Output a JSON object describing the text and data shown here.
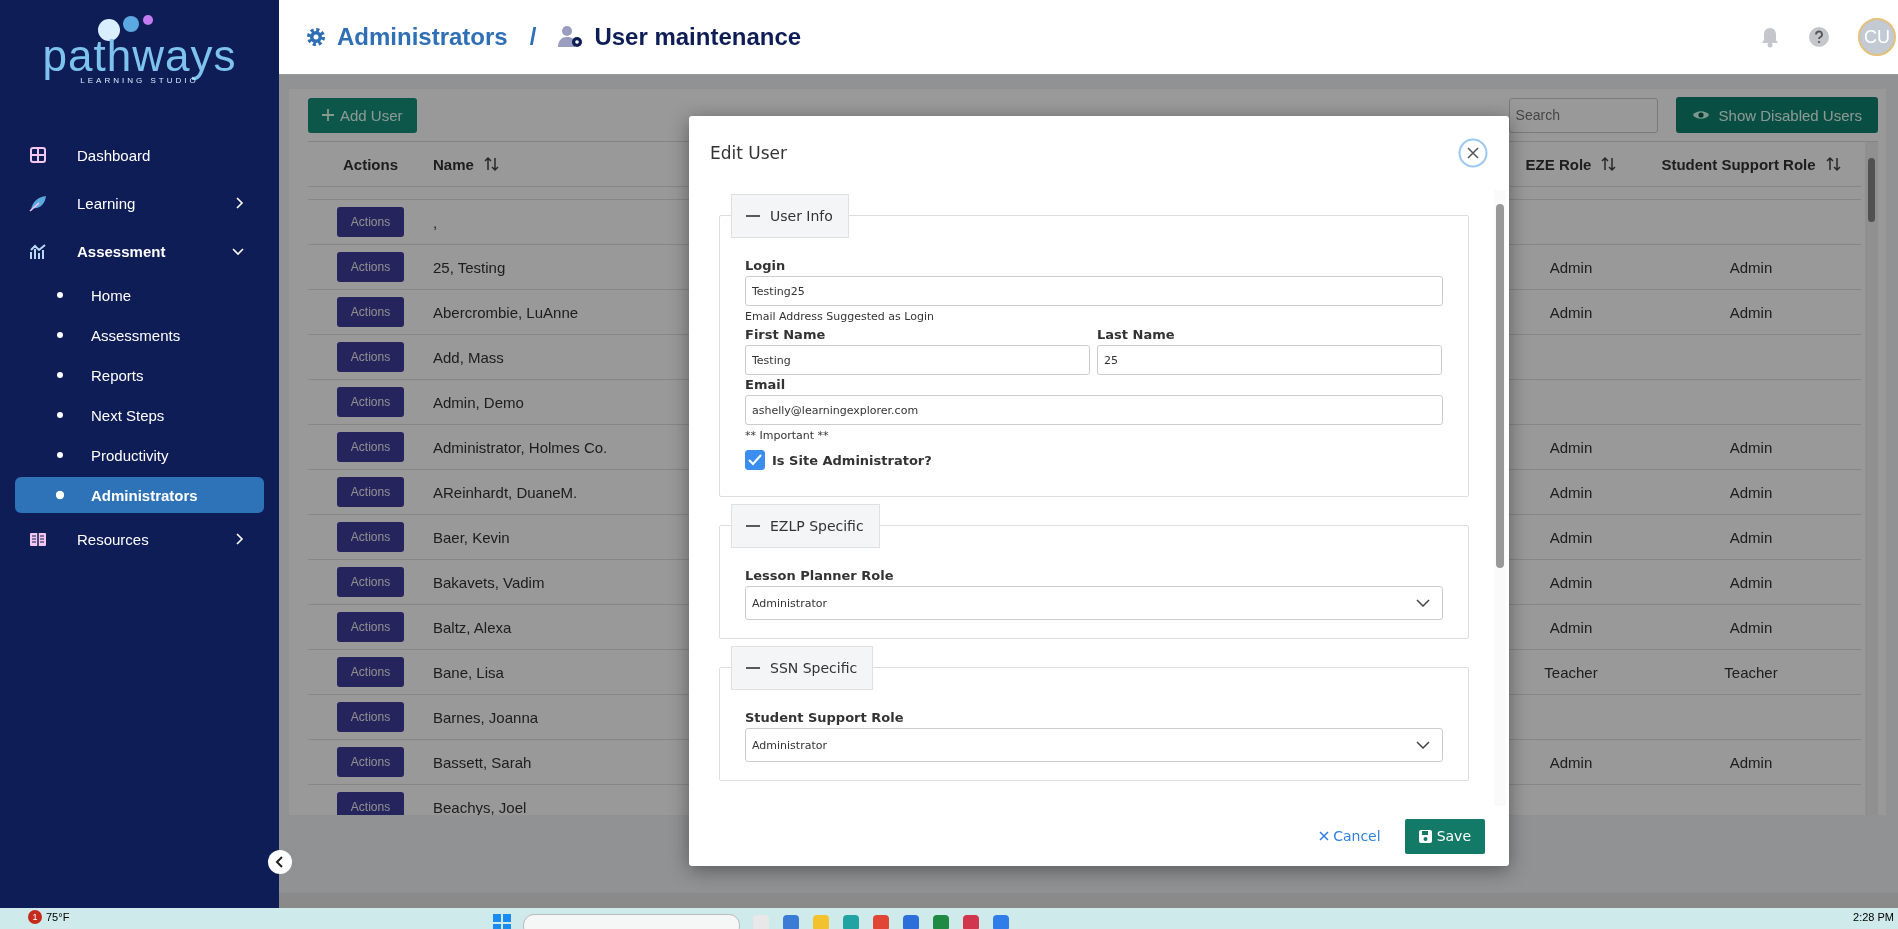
{
  "sidebar": {
    "logo": {
      "title": "pathways",
      "subtitle": "LEARNING STUDIO"
    },
    "items": [
      {
        "label": "Dashboard",
        "selected": false
      },
      {
        "label": "Learning",
        "expanded": false,
        "selected": false,
        "has_children": true
      },
      {
        "label": "Assessment",
        "expanded": true,
        "selected": false,
        "children": [
          {
            "label": "Home",
            "selected": false
          },
          {
            "label": "Assessments",
            "selected": false
          },
          {
            "label": "Reports",
            "selected": false
          },
          {
            "label": "Next Steps",
            "selected": false
          },
          {
            "label": "Productivity",
            "selected": false
          },
          {
            "label": "Administrators",
            "selected": true
          }
        ]
      },
      {
        "label": "Resources",
        "expanded": false,
        "selected": false,
        "has_children": true
      }
    ]
  },
  "header": {
    "breadcrumb": [
      {
        "text": "Administrators",
        "kind": "link"
      },
      {
        "text": "User maintenance",
        "kind": "current"
      }
    ],
    "separator": "/",
    "avatar": "CU"
  },
  "toolbar": {
    "add_button": "Add User",
    "search": {
      "placeholder": "Search"
    },
    "show_disabled_button": "Show Disabled Users"
  },
  "table": {
    "columns": [
      {
        "label": "Actions",
        "sortable": false
      },
      {
        "label": "Name",
        "sortable": true
      },
      {
        "label": "EZE Role",
        "sortable": true
      },
      {
        "label": "Student Support Role",
        "sortable": true
      }
    ],
    "rows": [
      {
        "action": "Actions",
        "name": ",",
        "eze_role": "",
        "support_role": ""
      },
      {
        "action": "Actions",
        "name": "25, Testing",
        "eze_role": "Admin",
        "support_role": "Admin"
      },
      {
        "action": "Actions",
        "name": "Abercrombie, LuAnne",
        "eze_role": "Admin",
        "support_role": "Admin"
      },
      {
        "action": "Actions",
        "name": "Add, Mass",
        "eze_role": "",
        "support_role": ""
      },
      {
        "action": "Actions",
        "name": "Admin, Demo",
        "eze_role": "",
        "support_role": ""
      },
      {
        "action": "Actions",
        "name": "Administrator, Holmes Co.",
        "eze_role": "Admin",
        "support_role": "Admin"
      },
      {
        "action": "Actions",
        "name": "AReinhardt, DuaneM.",
        "eze_role": "Admin",
        "support_role": "Admin"
      },
      {
        "action": "Actions",
        "name": "Baer, Kevin",
        "eze_role": "Admin",
        "support_role": "Admin"
      },
      {
        "action": "Actions",
        "name": "Bakavets, Vadim",
        "eze_role": "Admin",
        "support_role": "Admin"
      },
      {
        "action": "Actions",
        "name": "Baltz, Alexa",
        "eze_role": "Admin",
        "support_role": "Admin"
      },
      {
        "action": "Actions",
        "name": "Bane, Lisa",
        "eze_role": "Teacher",
        "support_role": "Teacher"
      },
      {
        "action": "Actions",
        "name": "Barnes, Joanna",
        "eze_role": "",
        "support_role": ""
      },
      {
        "action": "Actions",
        "name": "Bassett, Sarah",
        "eze_role": "Admin",
        "support_role": "Admin"
      },
      {
        "action": "Actions",
        "name": "Beachys, Joel",
        "eze_role": "",
        "support_role": ""
      }
    ]
  },
  "modal": {
    "title": "Edit User",
    "sections": [
      {
        "title": "User Info",
        "expanded": true,
        "fields": [
          {
            "kind": "text",
            "label": "Login",
            "value": "Testing25",
            "help": "Email Address Suggested as Login"
          },
          {
            "kind": "half",
            "label": "First Name",
            "value": "Testing"
          },
          {
            "kind": "half",
            "label": "Last Name",
            "value": "25"
          },
          {
            "kind": "text",
            "label": "Email",
            "value": "ashelly@learningexplorer.com",
            "help": "** Important **"
          },
          {
            "kind": "checkbox",
            "label": "Is Site Administrator?",
            "checked": true
          }
        ]
      },
      {
        "title": "EZLP Specific",
        "expanded": true,
        "fields": [
          {
            "kind": "select",
            "label": "Lesson Planner Role",
            "value": "Administrator"
          }
        ]
      },
      {
        "title": "SSN Specific",
        "expanded": true,
        "fields": [
          {
            "kind": "select",
            "label": "Student Support Role",
            "value": "Administrator"
          }
        ]
      }
    ],
    "cancel": "Cancel",
    "save": "Save"
  },
  "taskbar": {
    "weather_badge": "1",
    "temperature": "75°F",
    "time": "2:28 PM"
  }
}
